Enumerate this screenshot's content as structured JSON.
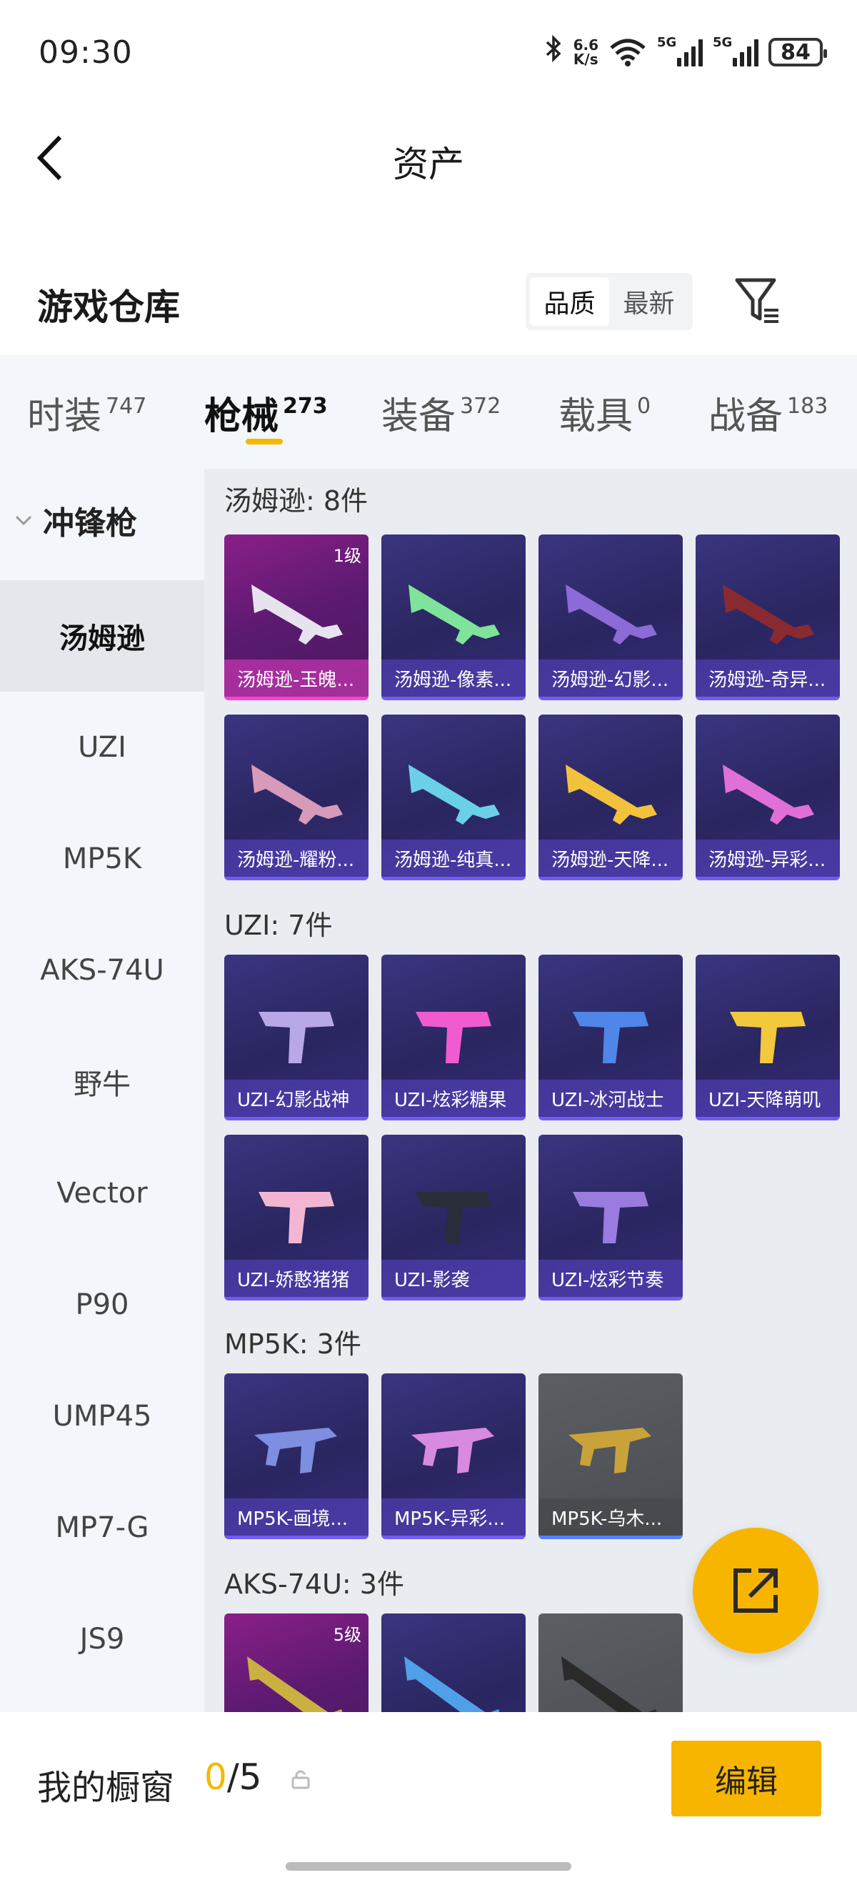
{
  "status": {
    "time": "09:30",
    "speed_top": "6.6",
    "speed_bottom": "K/s",
    "net1": "5G",
    "net2": "5G",
    "battery": "84"
  },
  "header": {
    "title": "资产"
  },
  "section": {
    "title": "游戏仓库",
    "sort_quality": "品质",
    "sort_newest": "最新"
  },
  "tabs": [
    {
      "label": "时装",
      "count": "747"
    },
    {
      "label": "枪械",
      "count": "273"
    },
    {
      "label": "装备",
      "count": "372"
    },
    {
      "label": "载具",
      "count": "0"
    },
    {
      "label": "战备",
      "count": "183"
    }
  ],
  "sidenav": {
    "category": "冲锋枪",
    "items": [
      "汤姆逊",
      "UZI",
      "MP5K",
      "AKS-74U",
      "野牛",
      "Vector",
      "P90",
      "UMP45",
      "MP7-G",
      "JS9"
    ]
  },
  "groups": [
    {
      "title": "汤姆逊: 8件",
      "items": [
        {
          "name": "汤姆逊-玉魄...",
          "level": "1级"
        },
        {
          "name": "汤姆逊-像素..."
        },
        {
          "name": "汤姆逊-幻影..."
        },
        {
          "name": "汤姆逊-奇异..."
        },
        {
          "name": "汤姆逊-耀粉..."
        },
        {
          "name": "汤姆逊-纯真..."
        },
        {
          "name": "汤姆逊-天降..."
        },
        {
          "name": "汤姆逊-异彩..."
        }
      ]
    },
    {
      "title": "UZI: 7件",
      "items": [
        {
          "name": "UZI-幻影战神"
        },
        {
          "name": "UZI-炫彩糖果"
        },
        {
          "name": "UZI-冰河战士"
        },
        {
          "name": "UZI-天降萌叽"
        },
        {
          "name": "UZI-娇憨猪猪"
        },
        {
          "name": "UZI-影袭"
        },
        {
          "name": "UZI-炫彩节奏"
        }
      ]
    },
    {
      "title": "MP5K: 3件",
      "items": [
        {
          "name": "MP5K-画境..."
        },
        {
          "name": "MP5K-异彩..."
        },
        {
          "name": "MP5K-乌木..."
        }
      ]
    },
    {
      "title": "AKS-74U: 3件",
      "items": [
        {
          "name": "",
          "level": "5级"
        },
        {
          "name": ""
        },
        {
          "name": ""
        }
      ]
    }
  ],
  "bottom": {
    "title": "我的橱窗",
    "current": "0",
    "total": "/5",
    "edit": "编辑"
  }
}
